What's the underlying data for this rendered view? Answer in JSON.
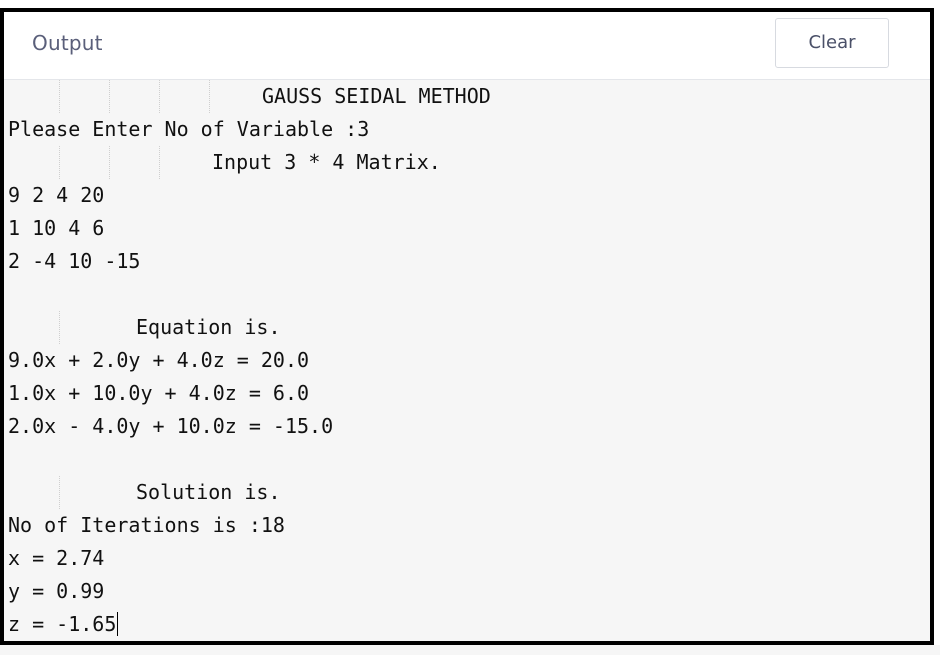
{
  "header": {
    "title": "Output",
    "clear_label": "Clear"
  },
  "console": {
    "lines": [
      "\t\t\t\tGAUSS SEIDAL METHOD",
      "Please Enter No of Variable :3",
      "\t\t\tInput 3 * 4 Matrix.",
      "9 2 4 20",
      "1 10 4 6",
      "2 -4 10 -15",
      "",
      "\t\tEquation is.",
      "9.0x + 2.0y + 4.0z = 20.0",
      "1.0x + 10.0y + 4.0z = 6.0",
      "2.0x - 4.0y + 10.0z = -15.0",
      "",
      "\t\tSolution is.",
      "No of Iterations is :18",
      "x = 2.74",
      "y = 0.99",
      "z = -1.65"
    ]
  }
}
